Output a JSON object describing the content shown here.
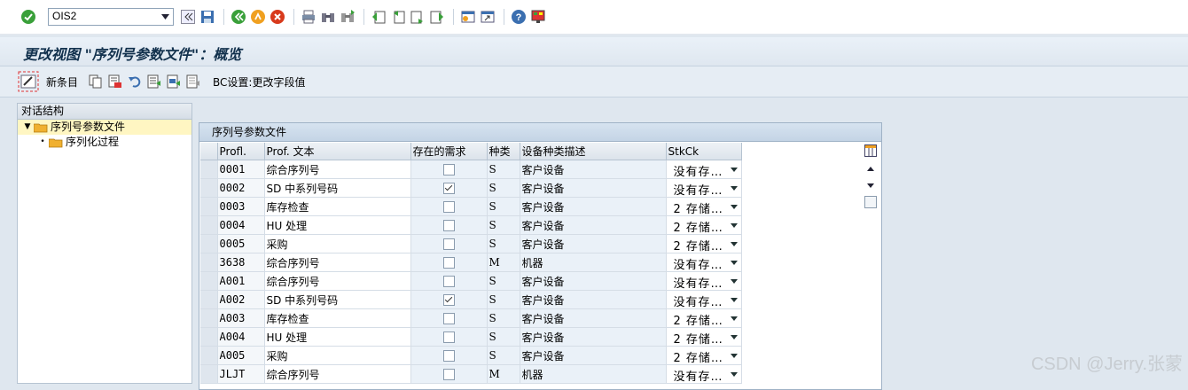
{
  "toolbar": {
    "command_value": "OIS2"
  },
  "title": "更改视图 \"序列号参数文件\"：概览",
  "app_toolbar": {
    "new_entries": "新条目",
    "bc_set": "BC设置:更改字段值"
  },
  "tree": {
    "header": "对话结构",
    "items": [
      {
        "label": "序列号参数文件",
        "selected": true,
        "expanded": true
      },
      {
        "label": "序列化过程",
        "selected": false
      }
    ]
  },
  "table": {
    "title": "序列号参数文件",
    "columns": [
      "Profl.",
      "Prof. 文本",
      "存在的需求",
      "种类",
      "设备种类描述",
      "StkCk"
    ],
    "rows": [
      {
        "profl": "0001",
        "text": "综合序列号",
        "req": false,
        "type": "S",
        "desc": "客户设备",
        "stk": "没有存…"
      },
      {
        "profl": "0002",
        "text": "SD 中系列号码",
        "req": true,
        "type": "S",
        "desc": "客户设备",
        "stk": "没有存…"
      },
      {
        "profl": "0003",
        "text": "库存检查",
        "req": false,
        "type": "S",
        "desc": "客户设备",
        "stk": "2 存储…"
      },
      {
        "profl": "0004",
        "text": "HU 处理",
        "req": false,
        "type": "S",
        "desc": "客户设备",
        "stk": "2 存储…"
      },
      {
        "profl": "0005",
        "text": "采购",
        "req": false,
        "type": "S",
        "desc": "客户设备",
        "stk": "2 存储…"
      },
      {
        "profl": "3638",
        "text": "综合序列号",
        "req": false,
        "type": "M",
        "desc": "机器",
        "stk": "没有存…"
      },
      {
        "profl": "A001",
        "text": "综合序列号",
        "req": false,
        "type": "S",
        "desc": "客户设备",
        "stk": "没有存…"
      },
      {
        "profl": "A002",
        "text": "SD 中系列号码",
        "req": true,
        "type": "S",
        "desc": "客户设备",
        "stk": "没有存…"
      },
      {
        "profl": "A003",
        "text": "库存检查",
        "req": false,
        "type": "S",
        "desc": "客户设备",
        "stk": "2 存储…"
      },
      {
        "profl": "A004",
        "text": "HU 处理",
        "req": false,
        "type": "S",
        "desc": "客户设备",
        "stk": "2 存储…"
      },
      {
        "profl": "A005",
        "text": "采购",
        "req": false,
        "type": "S",
        "desc": "客户设备",
        "stk": "2 存储…"
      },
      {
        "profl": "JLJT",
        "text": "综合序列号",
        "req": false,
        "type": "M",
        "desc": "机器",
        "stk": "没有存…"
      }
    ]
  },
  "watermark": "CSDN @Jerry.张蒙",
  "colors": {
    "enter_green": "#3aa03a",
    "header_blue": "#12314d",
    "tree_selected": "#fff6c2"
  },
  "icons": [
    "check-icon",
    "history-icon",
    "save-icon",
    "back-icon",
    "exit-icon",
    "cancel-icon",
    "print-icon",
    "find-icon",
    "find-next-icon",
    "first-page-icon",
    "prev-page-icon",
    "next-page-icon",
    "last-page-icon",
    "new-session-icon",
    "shortcut-icon",
    "help-icon",
    "layout-icon"
  ]
}
